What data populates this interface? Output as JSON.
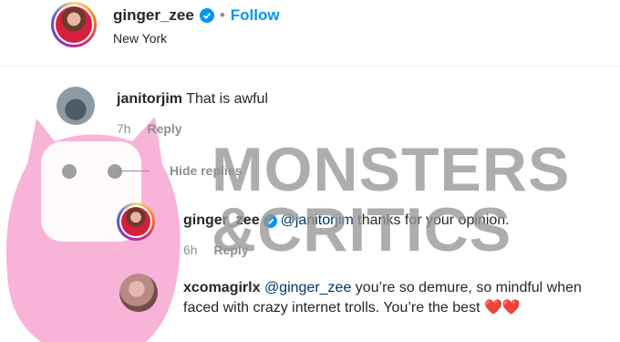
{
  "header": {
    "username": "ginger_zee",
    "separator": "•",
    "follow_label": "Follow",
    "location": "New York"
  },
  "comments": [
    {
      "username": "janitorjim",
      "text": "That is awful",
      "time": "7h",
      "reply_label": "Reply"
    },
    {
      "username": "ginger_zee",
      "mention": "@janitorjim",
      "text": " thanks for your opinion.",
      "time": "6h",
      "reply_label": "Reply"
    },
    {
      "username": "xcomagirlx",
      "mention": "@ginger_zee",
      "text": " you’re so demure, so mindful when faced with crazy internet trolls. You’re the best ❤️❤️"
    }
  ],
  "hide_replies_label": "Hide replies",
  "watermark": {
    "line1": "MONSTERS",
    "line2": "&CRITICS"
  },
  "colors": {
    "verified": "#0095f6",
    "follow": "#0095f6",
    "watermark_pink": "#f7b3d8"
  }
}
